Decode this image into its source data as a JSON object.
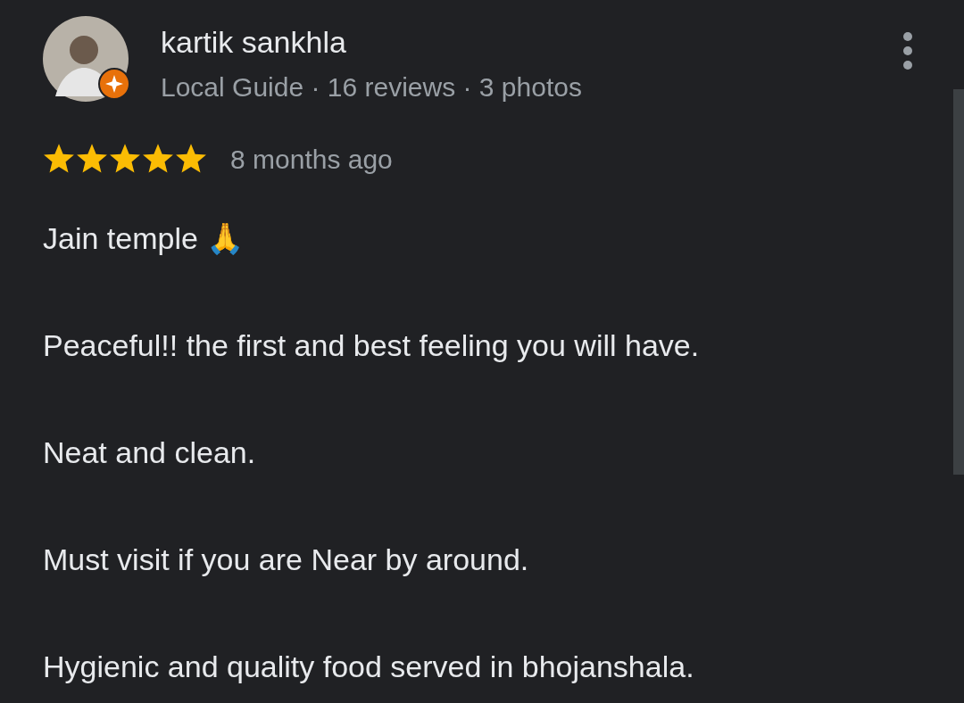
{
  "reviewer": {
    "name": "kartik sankhla",
    "local_guide": true,
    "subtitle": "Local Guide · 16 reviews · 3 photos"
  },
  "review": {
    "stars": 5,
    "time": "8 months ago",
    "paragraphs": [
      "Jain temple 🙏",
      "Peaceful!! the first and best feeling you will have.",
      "Neat and clean.",
      "Must visit if you are Near by around.",
      "Hygienic and quality food served in bhojanshala."
    ]
  }
}
